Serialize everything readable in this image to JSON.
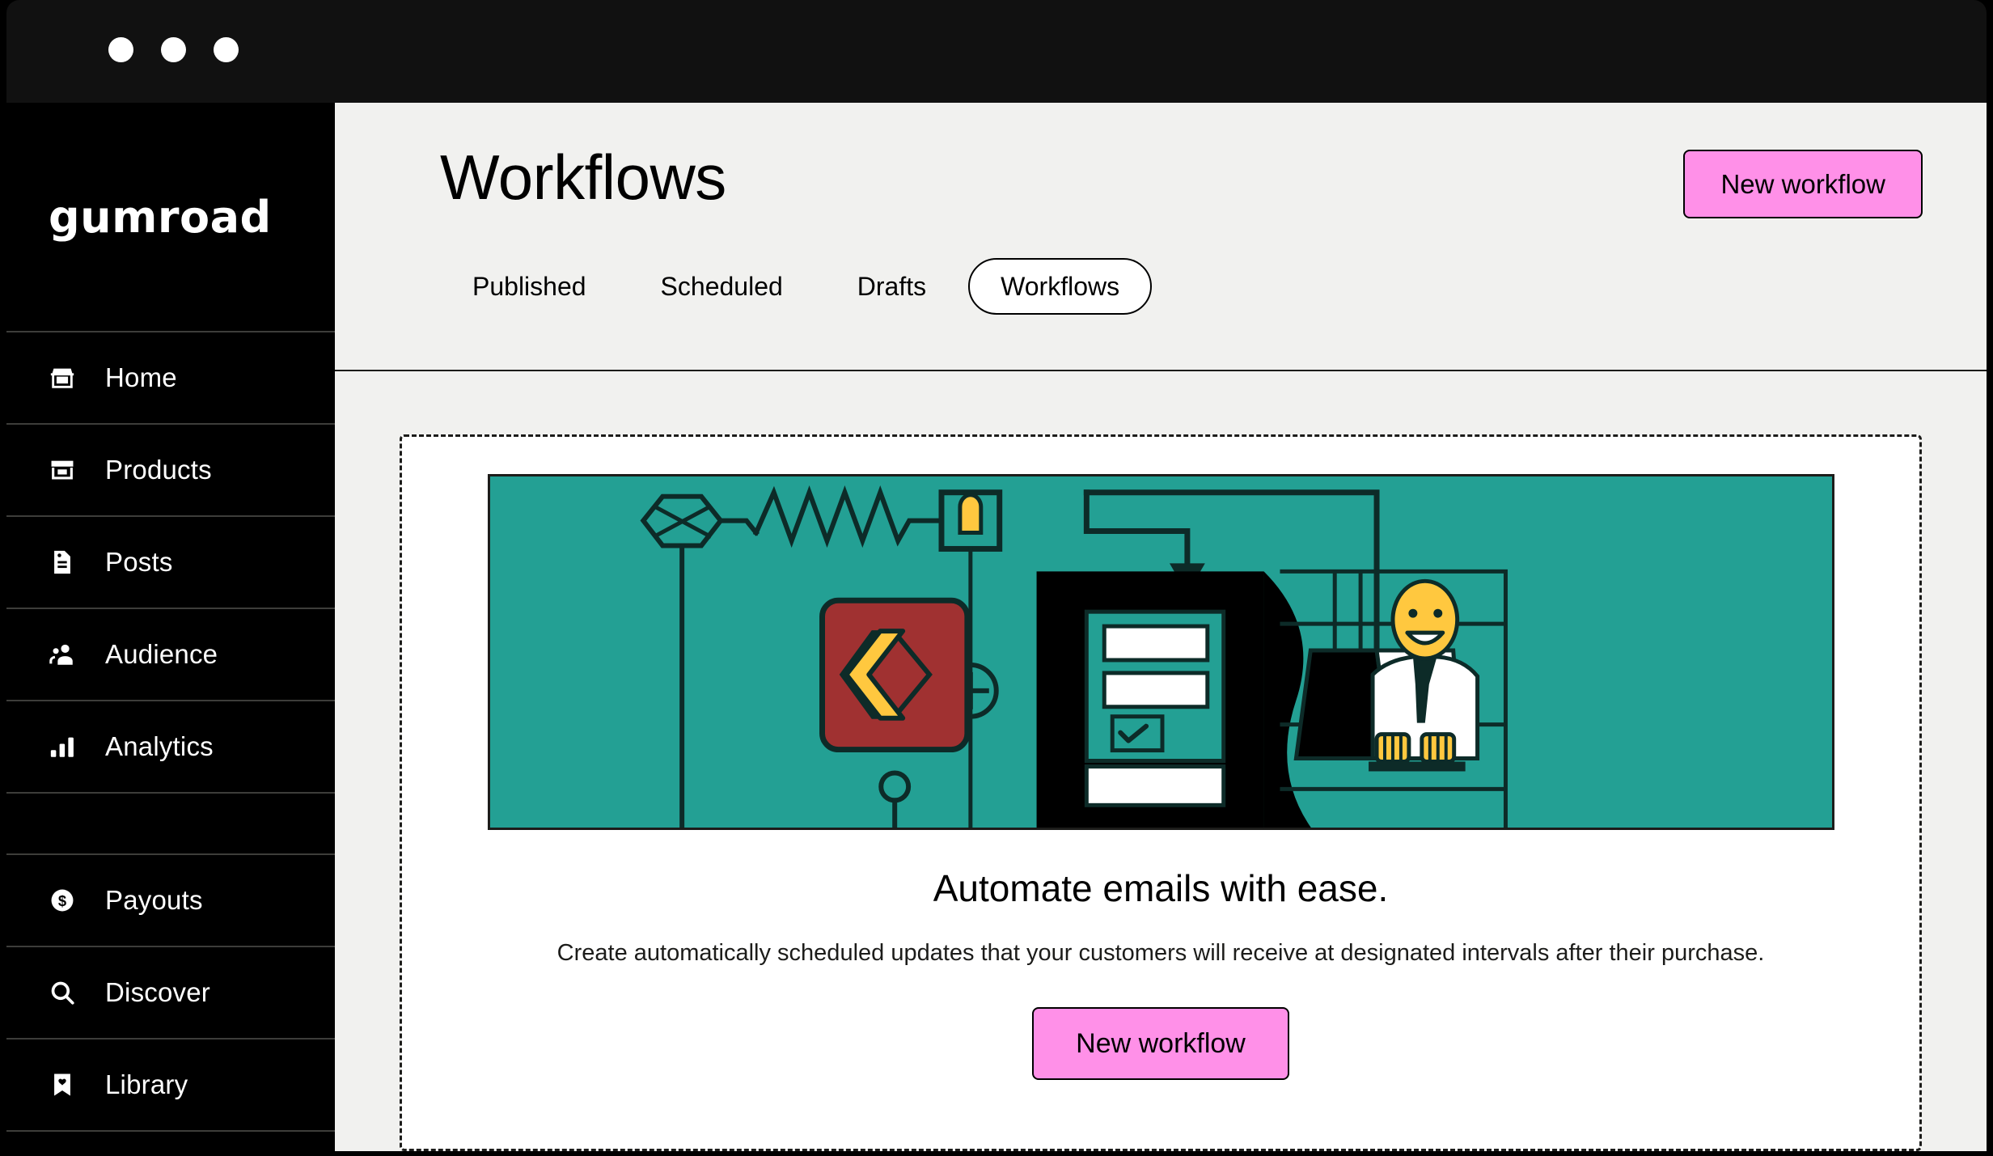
{
  "window": {
    "traffic_lights": [
      "close",
      "minimize",
      "maximize"
    ]
  },
  "sidebar": {
    "brand": "Gumroad",
    "items": [
      {
        "label": "Home",
        "icon": "storefront-icon"
      },
      {
        "label": "Products",
        "icon": "archive-box-icon"
      },
      {
        "label": "Posts",
        "icon": "document-icon"
      },
      {
        "label": "Audience",
        "icon": "people-icon"
      },
      {
        "label": "Analytics",
        "icon": "bar-chart-icon"
      }
    ],
    "items_secondary": [
      {
        "label": "Payouts",
        "icon": "dollar-coin-icon"
      },
      {
        "label": "Discover",
        "icon": "search-icon"
      },
      {
        "label": "Library",
        "icon": "bookmark-heart-icon"
      }
    ]
  },
  "header": {
    "title": "Workflows",
    "new_workflow_label": "New workflow",
    "tabs": [
      {
        "label": "Published",
        "active": false
      },
      {
        "label": "Scheduled",
        "active": false
      },
      {
        "label": "Drafts",
        "active": false
      },
      {
        "label": "Workflows",
        "active": true
      }
    ]
  },
  "empty_state": {
    "illustration_name": "automation-workflow-illustration",
    "heading": "Automate emails with ease.",
    "description": "Create automatically scheduled updates that your customers will receive at designated intervals after their purchase.",
    "cta_label": "New workflow"
  },
  "colors": {
    "accent_pink": "#ff90e8",
    "page_background": "#f1f1ef",
    "sidebar_background": "#000000",
    "illustration_teal": "#23a094",
    "illustration_yellow": "#ffc83f",
    "illustration_red": "#a03131",
    "ink": "#1c1c1a"
  }
}
